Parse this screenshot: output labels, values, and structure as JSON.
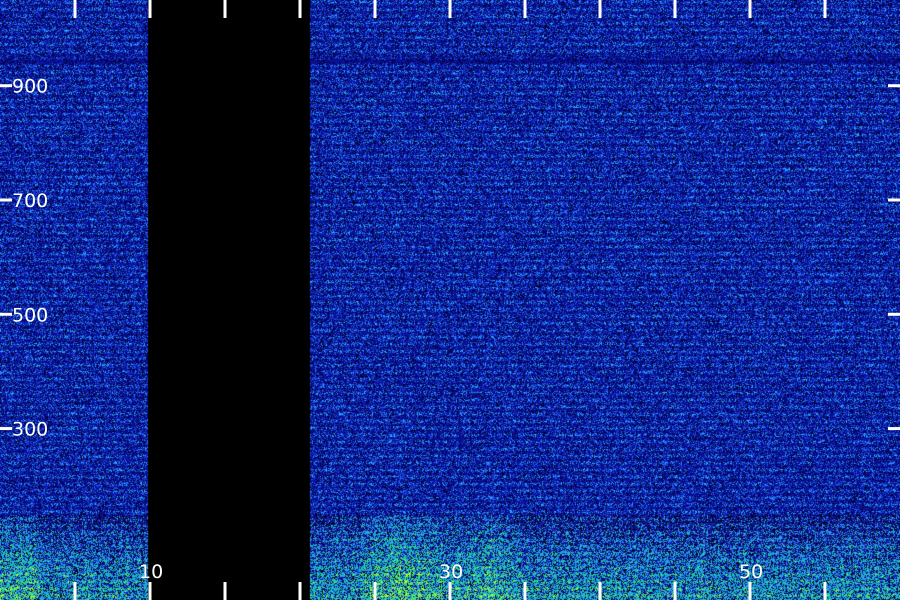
{
  "chart_data": {
    "type": "heatmap",
    "title": "",
    "xlabel": "",
    "ylabel": "",
    "x_range": [
      0,
      60
    ],
    "y_range": [
      0,
      1050
    ],
    "x_tick_labels": [
      "10",
      "30",
      "50"
    ],
    "y_tick_labels": [
      "300",
      "500",
      "700",
      "900"
    ],
    "x_ticks_labeled": [
      10,
      30,
      50
    ],
    "x_ticks_minor": [
      5,
      15,
      20,
      25,
      35,
      40,
      45,
      55
    ],
    "y_ticks": [
      300,
      500,
      700,
      900
    ],
    "gap": {
      "x_start": 9.8,
      "x_end": 20.6
    },
    "energy_band": {
      "y_max": 150
    },
    "colors": {
      "background": "#0a0f8a",
      "noise_low": "#000030",
      "noise_high": "#2aa6ff",
      "energy_mid": "#12c8b8",
      "energy_high": "#aaff2a",
      "gap": "#000000",
      "ticks": "#ffffff"
    }
  }
}
